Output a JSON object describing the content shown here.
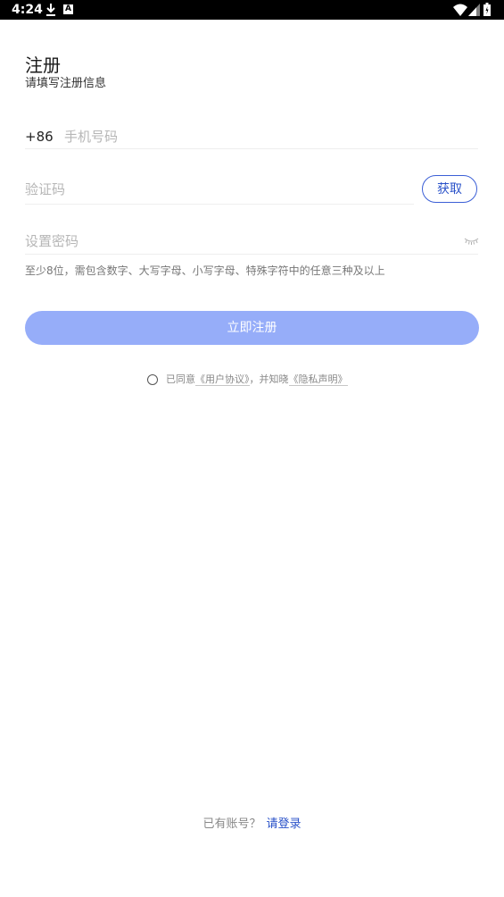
{
  "status_bar": {
    "time": "4:24",
    "icons": [
      "download-icon",
      "a-badge-icon",
      "wifi-icon",
      "signal-icon",
      "battery-icon"
    ]
  },
  "header": {
    "title": "注册",
    "subtitle": "请填写注册信息"
  },
  "form": {
    "country_code": "+86",
    "phone_placeholder": "手机号码",
    "code_placeholder": "验证码",
    "get_code_label": "获取",
    "password_placeholder": "设置密码",
    "password_icon": "eye-closed-icon",
    "password_hint": "至少8位，需包含数字、大写字母、小写字母、特殊字符中的任意三种及以上"
  },
  "submit": {
    "label": "立即注册"
  },
  "agreement": {
    "checked": false,
    "prefix": "已同意",
    "user_agreement": "《用户协议》",
    "middle": "，并知晓",
    "privacy": "《隐私声明》"
  },
  "footer": {
    "question": "已有账号？",
    "login_link": "请登录"
  },
  "colors": {
    "accent": "#2a52c9",
    "button_disabled": "#96adf9",
    "placeholder": "#b6b6b6"
  }
}
